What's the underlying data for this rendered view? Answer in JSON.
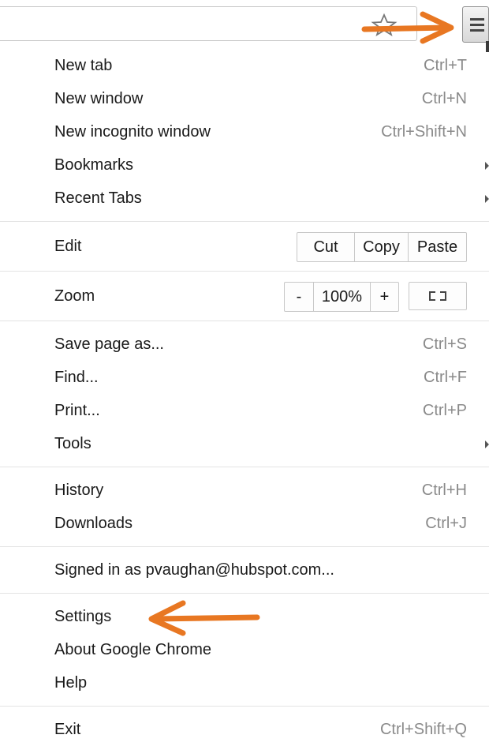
{
  "toolbar": {
    "star_icon": "star-icon",
    "menu_icon": "hamburger-menu-icon"
  },
  "menu": {
    "group1": [
      {
        "label": "New tab",
        "shortcut": "Ctrl+T"
      },
      {
        "label": "New window",
        "shortcut": "Ctrl+N"
      },
      {
        "label": "New incognito window",
        "shortcut": "Ctrl+Shift+N"
      },
      {
        "label": "Bookmarks",
        "submenu": true
      },
      {
        "label": "Recent Tabs",
        "submenu": true
      }
    ],
    "edit": {
      "label": "Edit",
      "cut": "Cut",
      "copy": "Copy",
      "paste": "Paste"
    },
    "zoom": {
      "label": "Zoom",
      "minus": "-",
      "level": "100%",
      "plus": "+"
    },
    "group2": [
      {
        "label": "Save page as...",
        "shortcut": "Ctrl+S"
      },
      {
        "label": "Find...",
        "shortcut": "Ctrl+F"
      },
      {
        "label": "Print...",
        "shortcut": "Ctrl+P"
      },
      {
        "label": "Tools",
        "submenu": true
      }
    ],
    "group3": [
      {
        "label": "History",
        "shortcut": "Ctrl+H"
      },
      {
        "label": "Downloads",
        "shortcut": "Ctrl+J"
      }
    ],
    "signed_in": "Signed in as pvaughan@hubspot.com...",
    "group4": [
      {
        "label": "Settings"
      },
      {
        "label": "About Google Chrome"
      },
      {
        "label": "Help"
      }
    ],
    "exit": {
      "label": "Exit",
      "shortcut": "Ctrl+Shift+Q"
    }
  },
  "colors": {
    "annotation_arrow": "#e87722",
    "shortcut_text": "#8a8a8a",
    "separator": "#e3e3e3"
  }
}
